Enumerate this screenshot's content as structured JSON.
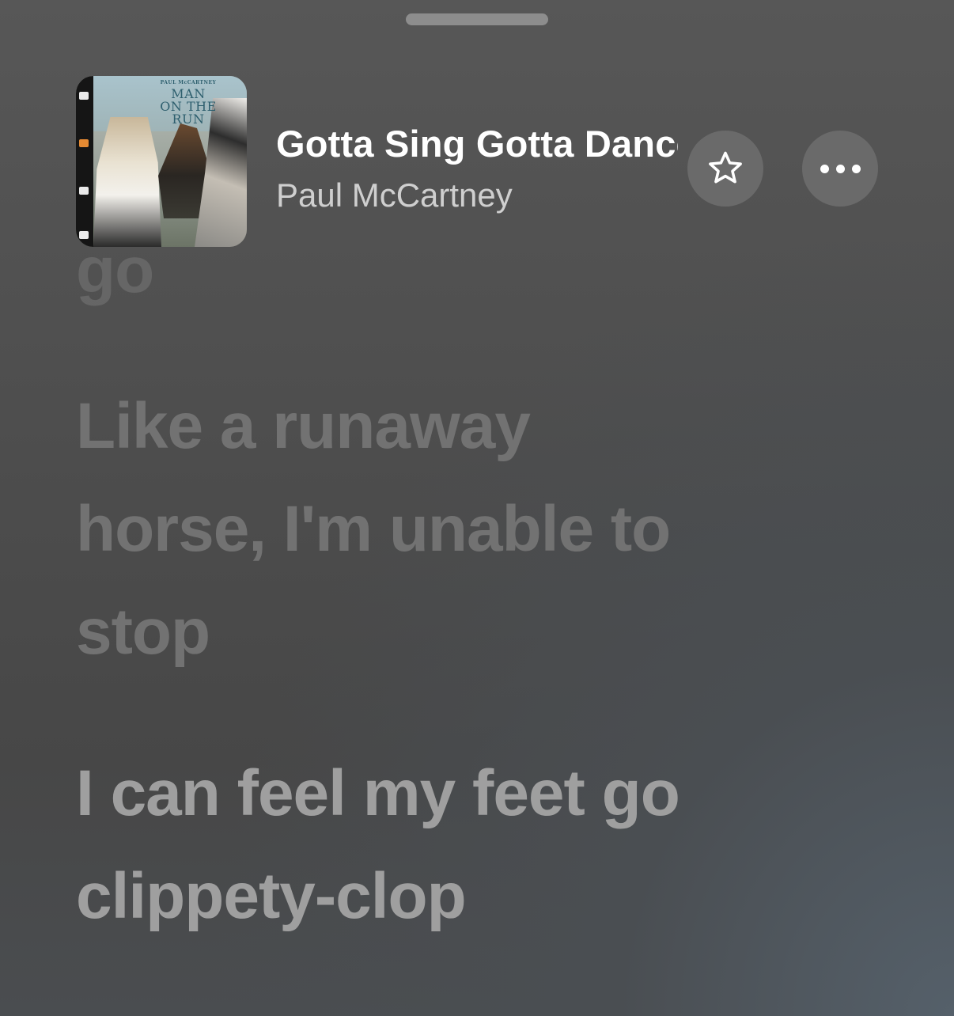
{
  "track": {
    "title": "Gotta Sing Gotta Dance",
    "artist": "Paul McCartney"
  },
  "album_art": {
    "text_small": "PAUL McCARTNEY",
    "text_large": "MAN ON THE RUN"
  },
  "actions": {
    "favorite_icon": "star-icon",
    "more_icon": "ellipsis-icon"
  },
  "lyrics": {
    "previous_tail": "go",
    "line_upcoming": "Like a runaway horse, I'm unable to stop",
    "line_current": "I can feel my feet go clippety-clop"
  }
}
